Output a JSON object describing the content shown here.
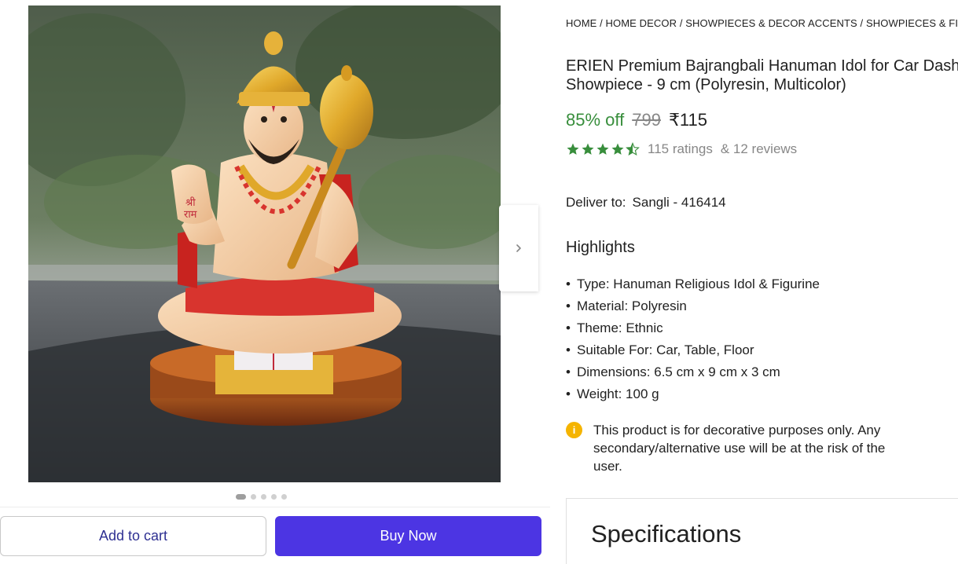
{
  "gallery": {
    "image_alt": "Hanuman idol on car dashboard",
    "dot_count": 5,
    "active_dot": 0
  },
  "actions": {
    "add_to_cart": "Add to cart",
    "buy_now": "Buy Now"
  },
  "breadcrumb": [
    "HOME",
    "HOME DECOR",
    "SHOWPIECES & DECOR ACCENTS",
    "SHOWPIECES & FIGURINES"
  ],
  "product": {
    "title": "ERIEN Premium Bajrangbali Hanuman Idol for Car Dashboard Showpiece  -  9 cm (Polyresin, Multicolor)",
    "discount": "85% off",
    "mrp": "799",
    "price": "₹115",
    "rating_value": 4.5,
    "ratings_text": "115 ratings",
    "reviews_text": "& 12 reviews"
  },
  "delivery": {
    "label": "Deliver to:",
    "location": "Sangli - 416414"
  },
  "highlights": {
    "title": "Highlights",
    "items": [
      "Type: Hanuman Religious Idol & Figurine",
      "Material: Polyresin",
      "Theme: Ethnic",
      "Suitable For: Car, Table, Floor",
      "Dimensions: 6.5 cm x 9 cm x 3 cm",
      "Weight: 100 g"
    ]
  },
  "notice": {
    "text": "This product is for decorative purposes only. Any secondary/alternative use will be at the risk of the user."
  },
  "specifications": {
    "title": "Specifications"
  },
  "colors": {
    "discount_green": "#388e3c",
    "star_green": "#388e3c",
    "buy_button": "#4c35e3",
    "cart_text": "#2e3092",
    "info_icon": "#f5b400"
  }
}
